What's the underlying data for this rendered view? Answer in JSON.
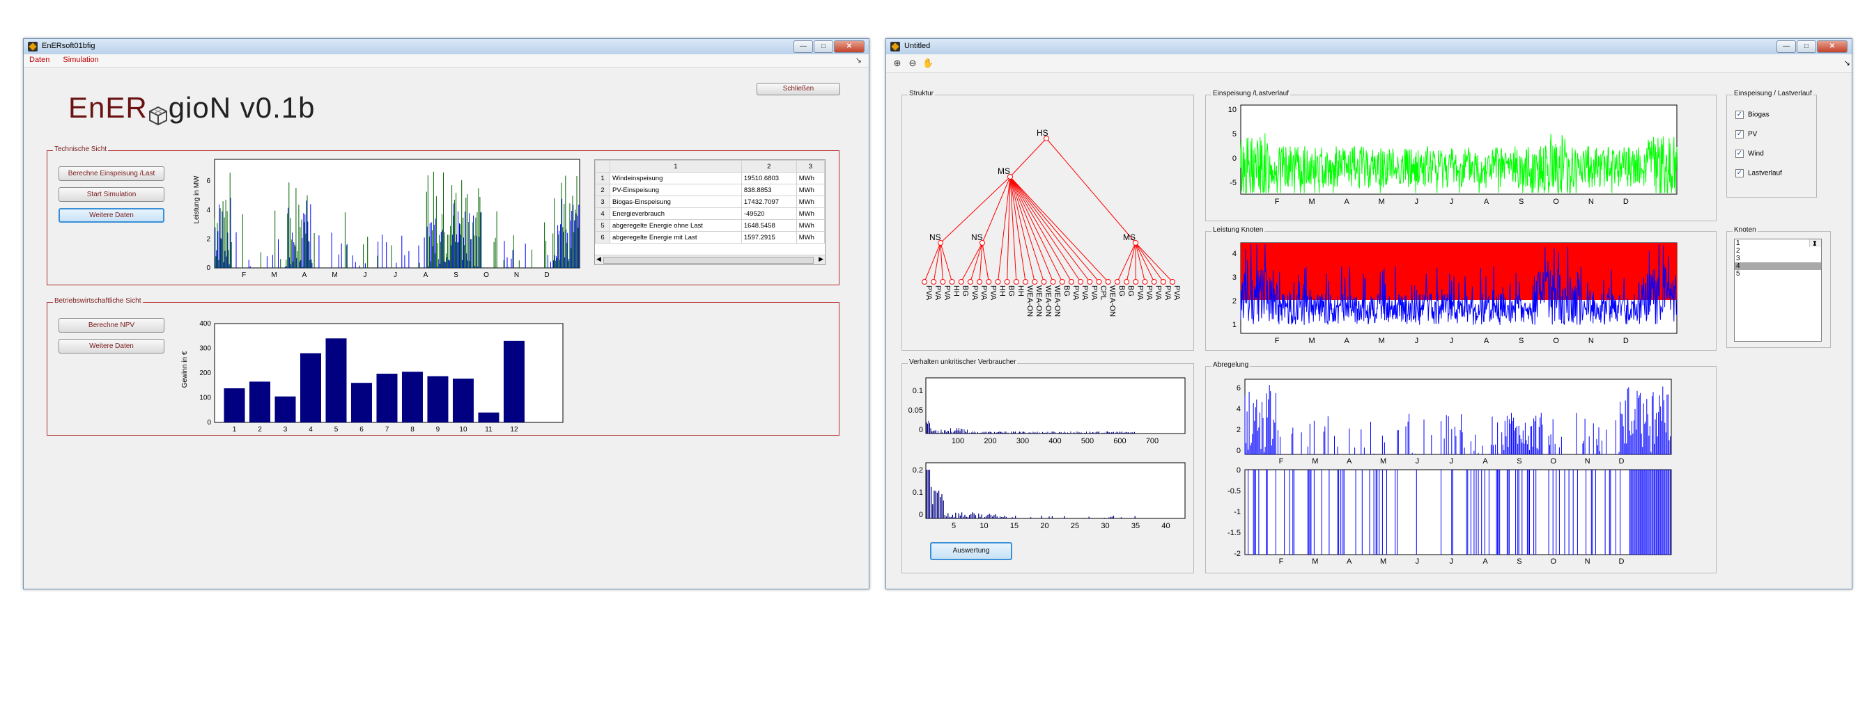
{
  "colors": {
    "accent_red": "#c00000",
    "bar_blue": "#000080",
    "green": "#00ff00",
    "blue": "#0000ff",
    "red_band": "#ff0000"
  },
  "left_window": {
    "title": "EnERsoft01bfig",
    "menu": [
      "Daten",
      "Simulation"
    ],
    "close_button": "Schließen",
    "logo": {
      "part1": "EnER",
      "icon": "cube-icon",
      "part2": "gioN v0.1b"
    },
    "technical_panel": {
      "title": "Technische Sicht",
      "buttons": [
        "Berechne Einspeisung /Last",
        "Start Simulation",
        "Weitere Daten"
      ],
      "chart": {
        "ylabel": "Leistung in MW",
        "yticks": [
          "0",
          "2",
          "4",
          "6"
        ],
        "months": [
          "F",
          "M",
          "A",
          "M",
          "J",
          "J",
          "A",
          "S",
          "O",
          "N",
          "D"
        ]
      },
      "table": {
        "headers": [
          "",
          "1",
          "2",
          "3"
        ],
        "rows": [
          [
            "1",
            "Windeinspeisung",
            "19510.6803",
            "MWh"
          ],
          [
            "2",
            "PV-Einspeisung",
            "838.8853",
            "MWh"
          ],
          [
            "3",
            "Biogas-Einspeisung",
            "17432.7097",
            "MWh"
          ],
          [
            "4",
            "Energieverbrauch",
            "-49520",
            "MWh"
          ],
          [
            "5",
            "abgeregelte Energie ohne Last",
            "1648.5458",
            "MWh"
          ],
          [
            "6",
            "abgeregelte Energie mit Last",
            "1597.2915",
            "MWh"
          ]
        ]
      }
    },
    "economic_panel": {
      "title": "Betriebswirtschaftliche Sicht",
      "buttons": [
        "Berechne NPV",
        "Weitere Daten"
      ]
    }
  },
  "chart_data": [
    {
      "type": "bar",
      "ylabel": "Gewinn in €",
      "categories": [
        "1",
        "2",
        "3",
        "4",
        "5",
        "6",
        "7",
        "8",
        "9",
        "10",
        "11",
        "12"
      ],
      "values": [
        138,
        165,
        105,
        280,
        340,
        160,
        197,
        205,
        187,
        177,
        40,
        330
      ],
      "ylim": [
        0,
        400
      ],
      "yticks": [
        "0",
        "100",
        "200",
        "300",
        "400"
      ]
    }
  ],
  "right_window": {
    "title": "Untitled",
    "toolbar_icons": [
      "zoom-in-icon",
      "zoom-out-icon",
      "pan-icon"
    ],
    "structure_panel": {
      "title": "Struktur",
      "nodes": {
        "hs": "HS",
        "ms1": "MS",
        "ms2": "MS",
        "ns1": "NS",
        "ns2": "NS"
      },
      "leaves": [
        "PVA",
        "PVA",
        "PVA",
        "HH",
        "BG",
        "PVA",
        "PVA",
        "PVA",
        "HH",
        "BG",
        "HH",
        "WEA-ON",
        "WEA-ON",
        "WEA-ON",
        "WEA-ON",
        "BG",
        "PVA",
        "PVA",
        "PVA",
        "CPL",
        "WEA-ON",
        "BG",
        "BG",
        "PVA",
        "PVA",
        "PVA",
        "PVA",
        "PVA"
      ]
    },
    "feed_panel": {
      "title": "Einspeisung /Lastverlauf",
      "yticks": [
        "10",
        "5",
        "0",
        "-5"
      ]
    },
    "node_power_panel": {
      "title": "Leistung Knoten",
      "yticks": [
        "4",
        "3",
        "2",
        "1"
      ]
    },
    "curtail_panel": {
      "title": "Abregelung",
      "top_yticks": [
        "6",
        "4",
        "2",
        "0"
      ],
      "bottom_yticks": [
        "0",
        "-0.5",
        "-1",
        "-1.5",
        "-2"
      ]
    },
    "months": [
      "F",
      "M",
      "A",
      "M",
      "J",
      "J",
      "A",
      "S",
      "O",
      "N",
      "D"
    ],
    "consumer_panel": {
      "title": "Verhalten unkritischer Verbraucher",
      "top_yticks": [
        "0.1",
        "0.05",
        "0"
      ],
      "top_xticks": [
        "100",
        "200",
        "300",
        "400",
        "500",
        "600",
        "700"
      ],
      "bottom_yticks": [
        "0.2",
        "0.1",
        "0"
      ],
      "bottom_xticks": [
        "5",
        "10",
        "15",
        "20",
        "25",
        "30",
        "35",
        "40"
      ],
      "button": "Auswertung"
    },
    "legend_panel": {
      "title": "Einspeisung / Lastverlauf",
      "items": [
        "Biogas",
        "PV",
        "Wind",
        "Lastverlauf"
      ]
    },
    "knoten_panel": {
      "title": "Knoten",
      "items": [
        "1",
        "2",
        "3",
        "4",
        "5"
      ],
      "selected": "4"
    }
  }
}
